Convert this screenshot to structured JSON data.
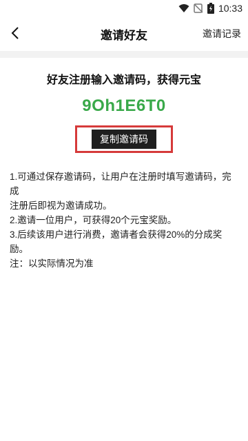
{
  "status_bar": {
    "time": "10:33",
    "icons": [
      "wifi-icon",
      "no-signal-icon",
      "battery-icon"
    ]
  },
  "header": {
    "title": "邀请好友",
    "back_icon": "chevron-left-icon",
    "records_label": "邀请记录"
  },
  "invite": {
    "headline": "好友注册输入邀请码，获得元宝",
    "code": "9Oh1E6T0",
    "copy_button_label": "复制邀请码",
    "highlight_color": "#d63a3a",
    "code_color": "#3aa94a"
  },
  "rules": {
    "line1a": "1.可通过保存邀请码，让用户在注册时填写邀请码，完成",
    "line1b": "注册后即视为邀请成功。",
    "line2": "2.邀请一位用户，可获得20个元宝奖励。",
    "line3": "3.后续该用户进行消费，邀请者会获得20%的分成奖励。",
    "note": "注：以实际情况为准"
  }
}
